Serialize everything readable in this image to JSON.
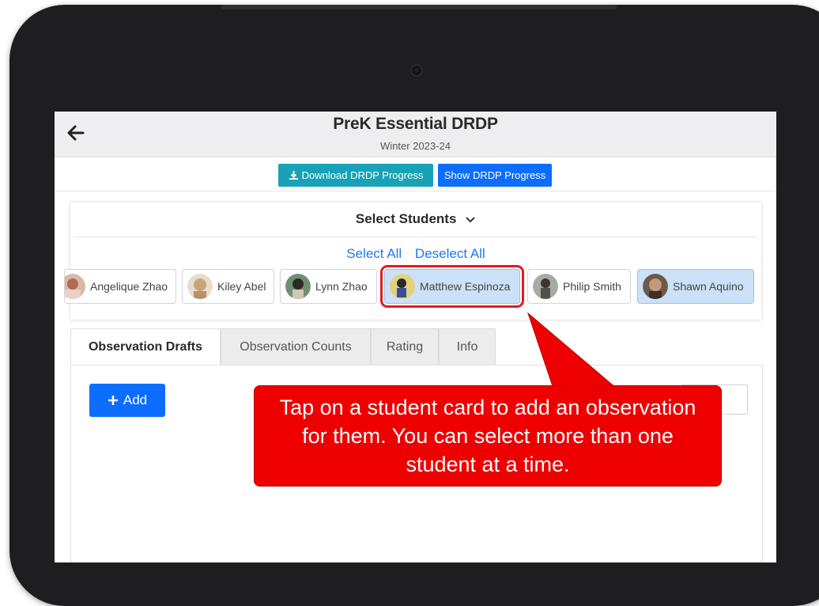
{
  "header": {
    "title": "PreK Essential DRDP",
    "subtitle": "Winter 2023-24"
  },
  "toolbar": {
    "download_label": "Download DRDP Progress",
    "show_label": "Show DRDP Progress"
  },
  "select_students": {
    "title": "Select Students",
    "select_all": "Select All",
    "deselect_all": "Deselect All",
    "students": [
      {
        "name": "Angelique Zhao",
        "selected": false
      },
      {
        "name": "Kiley Abel",
        "selected": false
      },
      {
        "name": "Lynn Zhao",
        "selected": false
      },
      {
        "name": "Matthew Espinoza",
        "selected": true,
        "highlighted": true
      },
      {
        "name": "Philip Smith",
        "selected": false
      },
      {
        "name": "Shawn Aquino",
        "selected": true
      }
    ]
  },
  "tabs": [
    {
      "label": "Observation Drafts",
      "active": true
    },
    {
      "label": "Observation Counts",
      "active": false
    },
    {
      "label": "Rating",
      "active": false
    },
    {
      "label": "Info",
      "active": false
    }
  ],
  "content": {
    "add_label": "Add"
  },
  "callout": {
    "text": "Tap on a student card to add an observation for them. You can select more than one student at a time."
  },
  "colors": {
    "teal_button": "#17a2b8",
    "blue_button": "#0d6efd",
    "link": "#1a7cf0",
    "selected_card": "#cce1f7",
    "callout_red": "#ee0000"
  }
}
